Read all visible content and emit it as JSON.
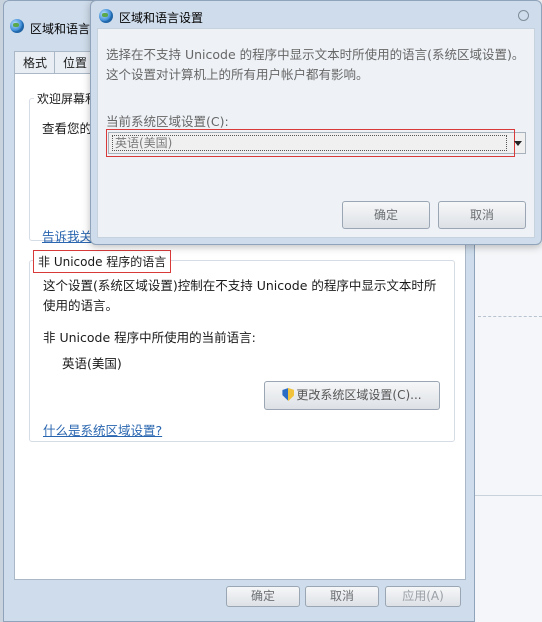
{
  "main_window": {
    "title": "区域和语言",
    "tabs": [
      {
        "label": "格式"
      },
      {
        "label": "位置"
      }
    ],
    "welcome_group": {
      "caption": "欢迎屏幕和",
      "text": "查看您的",
      "link": "告诉我关"
    },
    "unicode_group": {
      "caption": "非 Unicode 程序的语言",
      "description": "这个设置(系统区域设置)控制在不支持 Unicode 的程序中显示文本时所使用的语言。",
      "current_label": "非 Unicode 程序中所使用的当前语言:",
      "current_value": "英语(美国)",
      "change_button": "更改系统区域设置(C)...",
      "help_link": "什么是系统区域设置?"
    },
    "buttons": {
      "ok": "确定",
      "cancel": "取消",
      "apply": "应用(A)"
    }
  },
  "dialog": {
    "title": "区域和语言设置",
    "description": "选择在不支持 Unicode 的程序中显示文本时所使用的语言(系统区域设置)。这个设置对计算机上的所有用户帐户都有影响。",
    "field_label": "当前系统区域设置(C):",
    "selected_value": "英语(美国)",
    "ok_button": "确定",
    "cancel_button": "取消"
  },
  "icons": {
    "window": "globe-icon",
    "change_button": "shield-icon",
    "dropdown": "chevron-down-icon"
  },
  "colors": {
    "highlight": "#d83a3a",
    "link": "#2a66b0"
  }
}
